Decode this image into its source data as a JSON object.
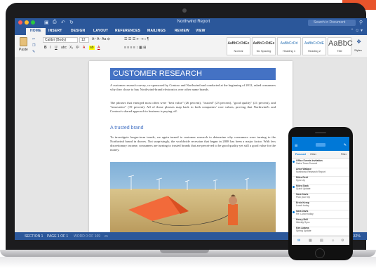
{
  "window": {
    "title": "Northwind Report",
    "search_placeholder": "Search in Document"
  },
  "colors": {
    "word_blue": "#2b579a",
    "heading_blue": "#4472c4",
    "accent_orange": "#e8542b",
    "outlook_blue": "#0078d7"
  },
  "tabs": [
    "HOME",
    "INSERT",
    "DESIGN",
    "LAYOUT",
    "REFERENCES",
    "MAILINGS",
    "REVIEW",
    "VIEW"
  ],
  "ribbon": {
    "paste_label": "Paste",
    "font_name": "Calibri (Body)",
    "font_size": "12",
    "styles_label": "Styles",
    "styles": [
      {
        "sample": "AaBbCcDdEe",
        "name": "Normal"
      },
      {
        "sample": "AaBbCcDdEe",
        "name": "No Spacing"
      },
      {
        "sample": "AaBbCcDd",
        "name": "Heading 1"
      },
      {
        "sample": "AaBbCcDdE",
        "name": "Heading 2"
      },
      {
        "sample": "AaBbC",
        "name": "Title"
      }
    ]
  },
  "document": {
    "heading": "CUSTOMER RESEARCH",
    "para1": "A customer research survey, co-sponsored by Contoso and Northwind and conducted at the beginning of 2012, asked consumers why they chose to buy Northwind-brand electronics over other name brands.",
    "para2": "The phrases that emerged most often were \"best value\" (26 percent), \"trusted\" (23 percent), \"good quality\" (21 percent), and \"innovative\" (19 percent). All of those phrases map back to both companies' core values, proving that Northwind's and Contoso's shared approach to business is paying off.",
    "subheading": "A trusted brand",
    "para3": "To investigate longer-term trends, we again turned to customer research to determine why consumers were turning to the Northwind brand in droves. Not surprisingly, the worldwide recession that began in 2008 has been a major factor. With less discretionary income, consumers are turning to trusted brands that are perceived to be good quality yet still a good value for the money."
  },
  "status": {
    "section": "SECTION 1",
    "page": "PAGE 1 OF 1",
    "words": "WORD 0 OF 169",
    "zoom": "132%"
  },
  "phone": {
    "tabs": [
      "Focused",
      "Other"
    ],
    "filter": "Filter",
    "mails": [
      {
        "from": "Office Events Invitation",
        "subject": "Sales Team Summit",
        "time": ""
      },
      {
        "from": "Anne Wallace",
        "subject": "Northwind Research Report",
        "time": ""
      },
      {
        "from": "Miles Reid",
        "subject": "Sync Up",
        "time": ""
      },
      {
        "from": "Miles Stark",
        "subject": "Quick Update",
        "time": ""
      },
      {
        "from": "Sara Davis",
        "subject": "Plan your trip",
        "time": ""
      },
      {
        "from": "Ernie Kemp",
        "subject": "Lunch today",
        "time": ""
      },
      {
        "from": "Sara Davis",
        "subject": "Re: Lunch today",
        "time": ""
      },
      {
        "from": "Henry Brill",
        "subject": "Weekly Sync",
        "time": ""
      },
      {
        "from": "Kim Adams",
        "subject": "Spring Update",
        "time": ""
      }
    ]
  }
}
